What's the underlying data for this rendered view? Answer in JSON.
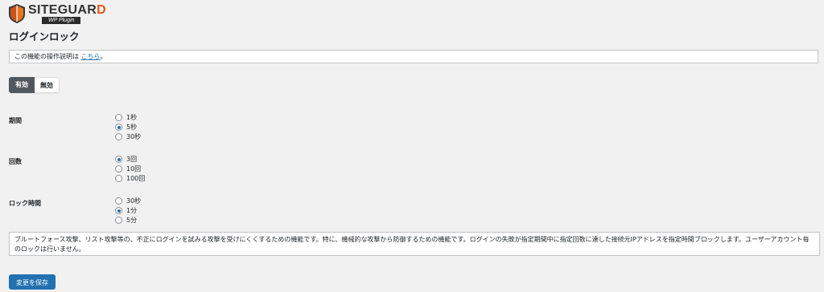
{
  "logo": {
    "title_main": "SITEGUAR",
    "title_accent": "D",
    "subtitle": "WP Plugin"
  },
  "page": {
    "title": "ログインロック"
  },
  "notice": {
    "text": "この機能の操作説明は",
    "link": "こちら",
    "suffix": "。"
  },
  "toggle": {
    "on_label": "有効",
    "off_label": "無効",
    "selected": "on"
  },
  "period": {
    "label": "期間",
    "options": [
      {
        "label": "1秒",
        "checked": false
      },
      {
        "label": "5秒",
        "checked": true
      },
      {
        "label": "30秒",
        "checked": false
      }
    ]
  },
  "count": {
    "label": "回数",
    "options": [
      {
        "label": "3回",
        "checked": true
      },
      {
        "label": "10回",
        "checked": false
      },
      {
        "label": "100回",
        "checked": false
      }
    ]
  },
  "lock_time": {
    "label": "ロック時間",
    "options": [
      {
        "label": "30秒",
        "checked": false
      },
      {
        "label": "1分",
        "checked": true
      },
      {
        "label": "5分",
        "checked": false
      }
    ]
  },
  "description": "ブルートフォース攻撃、リスト攻撃等の、不正にログインを試みる攻撃を受けにくくするための機能です。特に、機械的な攻撃から防御するための機能です。ログインの失敗が指定期間中に指定回数に達した接続元IPアドレスを指定時間ブロックします。ユーザーアカウント毎のロックは行いません。",
  "save_button": "変更を保存",
  "colors": {
    "accent": "#2271b1",
    "logo_accent": "#e05a1a",
    "toggle_active": "#50575e"
  }
}
